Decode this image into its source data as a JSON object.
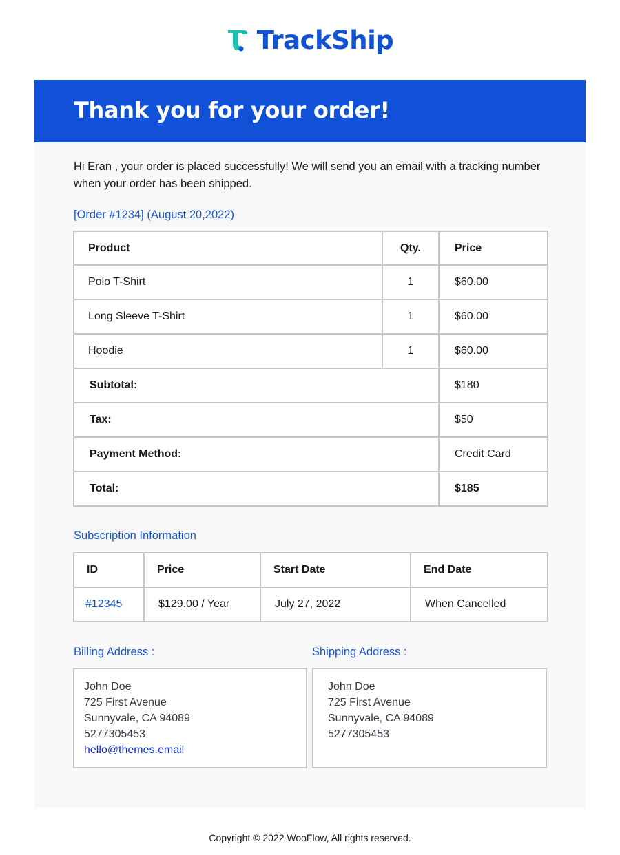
{
  "brand": {
    "name": "TrackShip",
    "logo_icon": "trackship-logo-icon",
    "colors": {
      "primary": "#1051d8",
      "logo_teal": "#1ac2b0",
      "link": "#1756d2"
    }
  },
  "banner": {
    "title": "Thank you for your order!"
  },
  "intro": "Hi Eran , your order is placed successfully! We will send you an email with a tracking number when your order has been shipped.",
  "order": {
    "heading": "[Order #1234] (August 20,2022)",
    "columns": [
      "Product",
      "Qty.",
      "Price"
    ],
    "items": [
      {
        "product": "Polo T-Shirt",
        "qty": "1",
        "price": "$60.00"
      },
      {
        "product": "Long Sleeve T-Shirt",
        "qty": "1",
        "price": "$60.00"
      },
      {
        "product": "Hoodie",
        "qty": "1",
        "price": "$60.00"
      }
    ],
    "summary": [
      {
        "label": "Subtotal:",
        "value": "$180"
      },
      {
        "label": "Tax:",
        "value": "$50"
      },
      {
        "label": "Payment Method:",
        "value": "Credit Card"
      },
      {
        "label": "Total:",
        "value": "$185"
      }
    ]
  },
  "subscription": {
    "heading": "Subscription Information",
    "columns": [
      "ID",
      "Price",
      "Start Date",
      "End Date"
    ],
    "row": {
      "id": "#12345",
      "price": "$129.00 / Year",
      "start": "July 27, 2022",
      "end": "When Cancelled"
    }
  },
  "billing": {
    "heading": "Billing Address :",
    "lines": [
      "John Doe",
      "725 First Avenue",
      "Sunnyvale, CA 94089",
      "5277305453"
    ],
    "email": "hello@themes.email"
  },
  "shipping": {
    "heading": "Shipping Address :",
    "lines": [
      "John Doe",
      "725 First Avenue",
      "Sunnyvale, CA 94089",
      "5277305453"
    ]
  },
  "footer": "Copyright © 2022 WooFlow, All rights reserved."
}
